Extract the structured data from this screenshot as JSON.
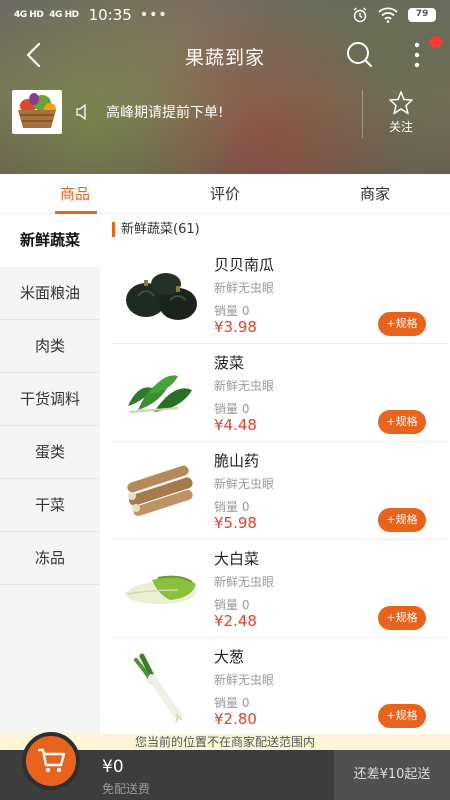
{
  "status_bar": {
    "signal1": "4G HD",
    "signal2": "4G HD",
    "time": "10:35",
    "more": "•••",
    "battery": "79"
  },
  "nav": {
    "title": "果蔬到家",
    "back_icon": "back-arrow-icon",
    "search_icon": "search-icon",
    "more_icon": "more-vertical-icon"
  },
  "shop": {
    "notice": "高峰期请提前下单!",
    "follow_label": "关注"
  },
  "tabs": [
    {
      "label": "商品",
      "active": true
    },
    {
      "label": "评价",
      "active": false
    },
    {
      "label": "商家",
      "active": false
    }
  ],
  "categories": [
    {
      "label": "新鲜蔬菜",
      "active": true
    },
    {
      "label": "米面粮油",
      "active": false
    },
    {
      "label": "肉类",
      "active": false
    },
    {
      "label": "干货调料",
      "active": false
    },
    {
      "label": "蛋类",
      "active": false
    },
    {
      "label": "干菜",
      "active": false
    },
    {
      "label": "冻品",
      "active": false
    }
  ],
  "section_title": "新鲜蔬菜(61)",
  "products": [
    {
      "name": "贝贝南瓜",
      "desc": "新鲜无虫眼",
      "sold": "销量 0",
      "price": "¥3.98",
      "spec": "+规格"
    },
    {
      "name": "菠菜",
      "desc": "新鲜无虫眼",
      "sold": "销量 0",
      "price": "¥4.48",
      "spec": "+规格"
    },
    {
      "name": "脆山药",
      "desc": "新鲜无虫眼",
      "sold": "销量 0",
      "price": "¥5.98",
      "spec": "+规格"
    },
    {
      "name": "大白菜",
      "desc": "新鲜无虫眼",
      "sold": "销量 0",
      "price": "¥2.48",
      "spec": "+规格"
    },
    {
      "name": "大葱",
      "desc": "新鲜无虫眼",
      "sold": "销量 0",
      "price": "¥2.80",
      "spec": "+规格"
    }
  ],
  "bottom": {
    "warning": "您当前的位置不在商家配送范围内",
    "total": "¥0",
    "free_shipping": "免配送费",
    "min_order": "还差¥10起送"
  },
  "colors": {
    "accent": "#e8631c",
    "price": "#e8412c",
    "cart_bar": "#3d3d3d"
  }
}
